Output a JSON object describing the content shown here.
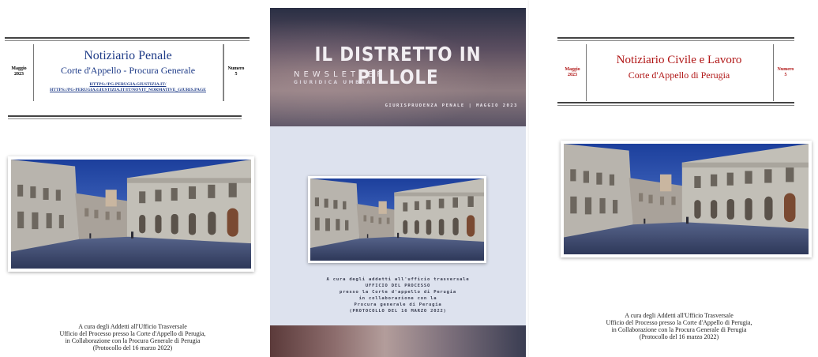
{
  "cover_penale": {
    "side_left": [
      "Maggio",
      "2023"
    ],
    "title": "Notiziario Penale",
    "subtitle": "Corte d'Appello - Procura Generale",
    "links": [
      "HTTPS://PG-PERUGIA.GIUSTIZIA.IT/",
      "HTTPS://PG-PERUGIA.GIUSTIZIA.IT/IT/NOVIT_NORMATIVE_GIURIS.PAGE"
    ],
    "side_right": [
      "Numero",
      "5"
    ],
    "credits": [
      "A cura degli Addetti all'Ufficio Trasversale",
      "Ufficio del Processo presso la Corte d'Appello di Perugia,",
      "in Collaborazione con la Procura Generale di Perugia",
      "(Protocollo del 16 marzo 2022)"
    ]
  },
  "cover_distretto": {
    "title": "IL DISTRETTO IN PILLOLE",
    "newsletter": "NEWSLETTER",
    "newsletter_sub": "GIURIDICA UMBRA",
    "section": "GIURISPRUDENZA PENALE | MAGGIO 2023",
    "credits": [
      "A cura degli addetti all'ufficio trasversale",
      "UFFICIO DEL PROCESSO",
      "presso la Corte d'appello di Perugia",
      "in collaborazione con la",
      "Procura generale di Perugia",
      "(PROTOCOLLO DEL 16 MARZO 2022)"
    ]
  },
  "cover_civile": {
    "side_left": [
      "Maggio",
      "2023"
    ],
    "title": "Notiziario Civile e Lavoro",
    "subtitle": "Corte d'Appello di Perugia",
    "side_right": [
      "Numero",
      "5"
    ],
    "credits": [
      "A cura degli Addetti all'Ufficio Trasversale",
      "Ufficio del Processo presso la Corte d'Appello di Perugia,",
      "in Collaborazione con la Procura Generale di Perugia",
      "(Protocollo del 16 marzo 2022)"
    ]
  },
  "colors": {
    "penale_title": "#1f3c88",
    "civile_title": "#b01515",
    "distretto_band": "#5b4e60",
    "distretto_body": "#dde2ee"
  }
}
